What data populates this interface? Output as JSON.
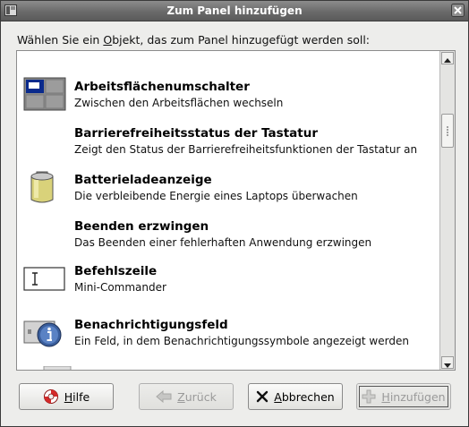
{
  "window": {
    "title": "Zum Panel hinzufügen"
  },
  "dialog": {
    "prompt_before": "Wählen Sie ein ",
    "prompt_mnemonic": "O",
    "prompt_after": "bjekt, das zum Panel hinzugefügt werden soll:"
  },
  "items": [
    {
      "name": "Arbeitsflächenumschalter",
      "description": "Zwischen den Arbeitsflächen wechseln",
      "icon": "workspace-switcher-icon"
    },
    {
      "name": "Barrierefreiheitsstatus der Tastatur",
      "description": "Zeigt den Status der Barrierefreiheitsfunktionen der Tastatur an",
      "icon": ""
    },
    {
      "name": "Batterieladeanzeige",
      "description": "Die verbleibende Energie eines Laptops überwachen",
      "icon": "battery-icon"
    },
    {
      "name": "Beenden erzwingen",
      "description": "Das Beenden einer fehlerhaften Anwendung erzwingen",
      "icon": ""
    },
    {
      "name": "Befehlszeile",
      "description": "Mini-Commander",
      "icon": "command-line-icon"
    },
    {
      "name": "Benachrichtigungsfeld",
      "description": "Ein Feld, in dem Benachrichtigungssymbole angezeigt werden",
      "icon": "notification-area-icon"
    }
  ],
  "buttons": {
    "help": {
      "mnemonic": "H",
      "rest": "ilfe",
      "icon": "lifebuoy-icon"
    },
    "back": {
      "mnemonic": "Z",
      "rest": "urück",
      "icon": "arrow-left-icon"
    },
    "cancel": {
      "mnemonic": "A",
      "rest": "bbrechen",
      "icon": "x-icon"
    },
    "add": {
      "mnemonic": "H",
      "rest": "inzufügen",
      "icon": "plus-icon"
    }
  },
  "colors": {
    "titlebar": "#6a6a6a",
    "background": "#ededeb",
    "list_background": "#ffffff",
    "text": "#000000",
    "disabled_text": "#9a9a9a"
  }
}
